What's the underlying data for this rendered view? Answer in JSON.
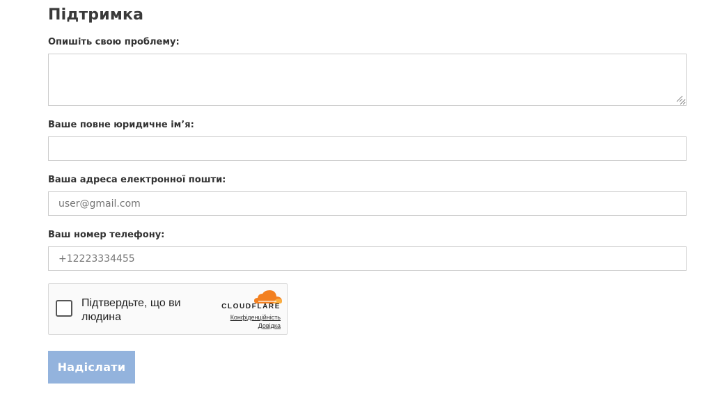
{
  "page": {
    "title": "Підтримка"
  },
  "form": {
    "problem": {
      "label": "Опишіть свою проблему:",
      "value": "",
      "placeholder": ""
    },
    "legal_name": {
      "label": "Ваше повне юридичне ім’я:",
      "value": "",
      "placeholder": ""
    },
    "email": {
      "label": "Ваша адреса електронної пошти:",
      "value": "",
      "placeholder": "user@gmail.com"
    },
    "phone": {
      "label": "Ваш номер телефону:",
      "value": "",
      "placeholder": "+12223334455"
    },
    "submit_label": "Надіслати"
  },
  "captcha": {
    "text": "Підтвердьте, що ви людина",
    "brand": "CLOUDFLARE",
    "privacy_link": "Конфіденційність",
    "help_link": "Довідка",
    "checked": false
  },
  "colors": {
    "submit_button": "#93b3dd",
    "cloudflare_orange": "#f38020",
    "cloudflare_orange_light": "#faae40"
  }
}
